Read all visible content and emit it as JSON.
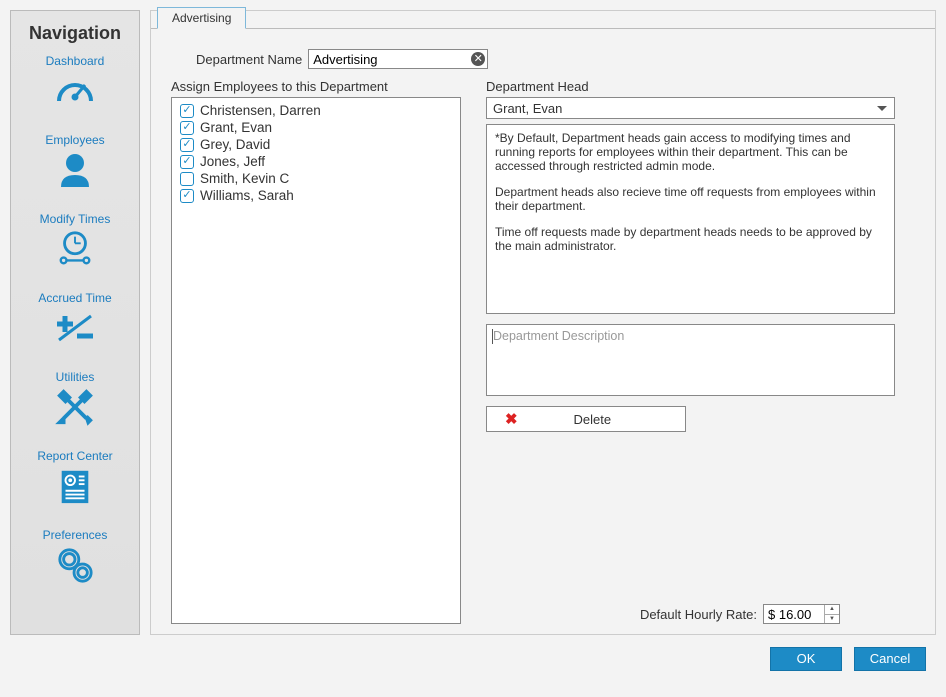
{
  "sidebar": {
    "title": "Navigation",
    "items": [
      {
        "label": "Dashboard"
      },
      {
        "label": "Employees"
      },
      {
        "label": "Modify Times"
      },
      {
        "label": "Accrued Time"
      },
      {
        "label": "Utilities"
      },
      {
        "label": "Report Center"
      },
      {
        "label": "Preferences"
      }
    ]
  },
  "tab": {
    "label": "Advertising"
  },
  "form": {
    "name_label": "Department Name",
    "name_value": "Advertising",
    "employees_label": "Assign Employees to this Department",
    "employees": [
      {
        "name": "Christensen, Darren",
        "checked": true
      },
      {
        "name": "Grant, Evan",
        "checked": true
      },
      {
        "name": "Grey, David",
        "checked": true
      },
      {
        "name": "Jones, Jeff",
        "checked": true
      },
      {
        "name": "Smith, Kevin C",
        "checked": false
      },
      {
        "name": "Williams, Sarah",
        "checked": true
      }
    ],
    "head_label": "Department Head",
    "head_value": "Grant, Evan",
    "info_p1": "*By Default, Department heads gain access to modifying times and running reports for employees within their department. This can be accessed through restricted admin mode.",
    "info_p2": "Department heads also recieve time off requests from employees within their department.",
    "info_p3": "Time off requests made by department heads needs to be approved by the main administrator.",
    "desc_placeholder": "Department Description",
    "delete_label": "Delete",
    "rate_label": "Default Hourly Rate:",
    "rate_value": "$ 16.00"
  },
  "buttons": {
    "ok": "OK",
    "cancel": "Cancel"
  }
}
